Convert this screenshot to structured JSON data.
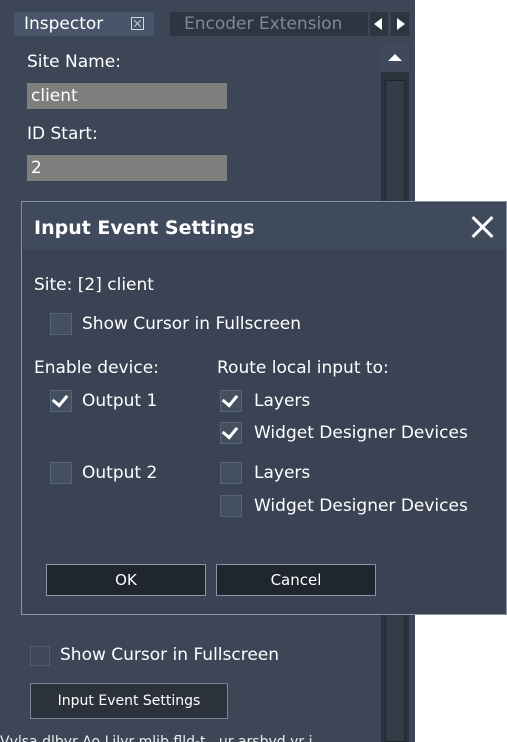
{
  "inspector": {
    "tab_active": "Inspector",
    "tab_inactive": "Encoder Extension",
    "site_name_label": "Site Name:",
    "site_name_value": "client",
    "id_start_label": "ID Start:",
    "id_start_value": "2",
    "show_cursor_label": "Show Cursor in Fullscreen",
    "input_event_button": "Input Event Settings",
    "cut_off_text": "Vvlsa dlbyr Ao Lilyr mlib flld-t...ur arsbvd yr i"
  },
  "dialog": {
    "title": "Input Event Settings",
    "site_text": "Site: [2] client",
    "show_cursor_label": "Show Cursor in Fullscreen",
    "enable_device_label": "Enable device:",
    "route_label": "Route local input to:",
    "output1_label": "Output 1",
    "output2_label": "Output 2",
    "layers_label": "Layers",
    "wd_devices_label": "Widget Designer Devices",
    "ok_label": "OK",
    "cancel_label": "Cancel"
  },
  "colors": {
    "panel_bg": "#3c4656",
    "dialog_bg": "#3a4353",
    "field_bg": "#7e7e7e",
    "text": "#ffffff"
  }
}
